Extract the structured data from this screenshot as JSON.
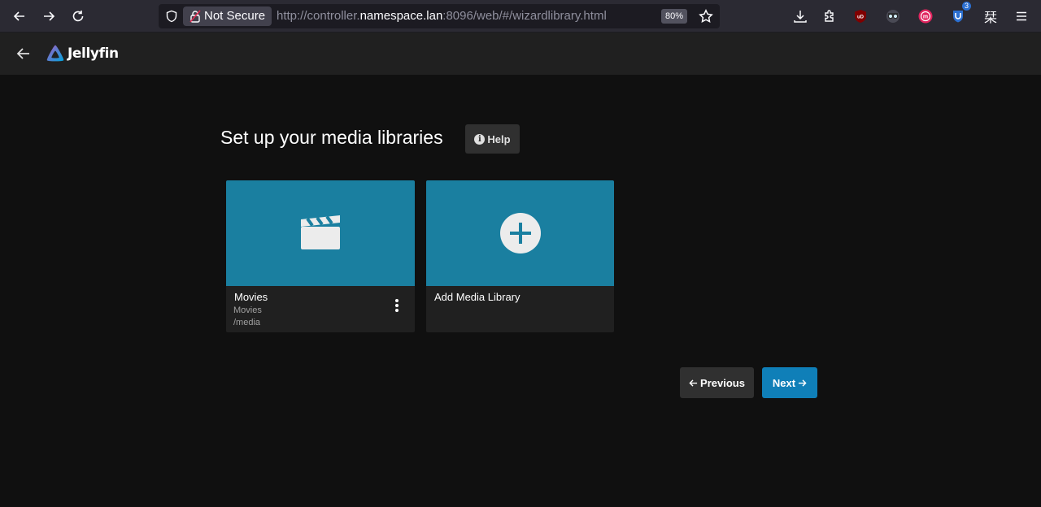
{
  "browser": {
    "security_label": "Not Secure",
    "url_prefix": "http://controller.",
    "url_host": "namespace.lan",
    "url_suffix": ":8096/web/#/wizardlibrary.html",
    "zoom": "80%",
    "extension_badge": "3",
    "kanji_icon": "栞"
  },
  "header": {
    "logo_text": "Jellyfin"
  },
  "page": {
    "title": "Set up your media libraries",
    "help_label": "Help"
  },
  "libraries": [
    {
      "title": "Movies",
      "type": "Movies",
      "path": "/media",
      "icon": "clapperboard-icon"
    }
  ],
  "add_card": {
    "title": "Add Media Library",
    "icon": "plus-circle-icon"
  },
  "footer": {
    "previous_label": "Previous",
    "next_label": "Next"
  },
  "colors": {
    "accent": "#0f7fb8",
    "card_image": "#1a7fa0",
    "background": "#101010",
    "header": "#202020"
  }
}
